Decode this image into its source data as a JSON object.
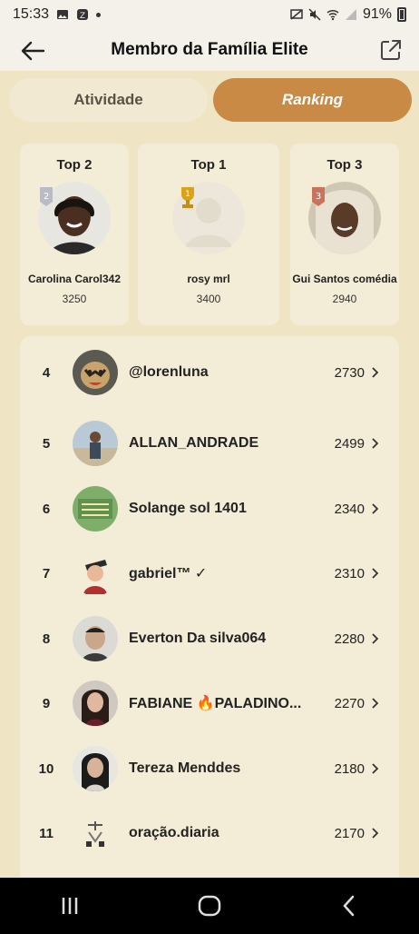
{
  "status_bar": {
    "time": "15:33",
    "battery": "91%"
  },
  "header": {
    "title": "Membro da Família Elite"
  },
  "tabs": [
    {
      "label": "Atividade",
      "active": false
    },
    {
      "label": "Ranking",
      "active": true
    }
  ],
  "podium": [
    {
      "rank_label": "Top 2",
      "name": "Carolina Carol342",
      "score": "3250",
      "badge_num": "2"
    },
    {
      "rank_label": "Top 1",
      "name": "rosy mrl",
      "score": "3400",
      "badge_num": "1"
    },
    {
      "rank_label": "Top 3",
      "name": "Gui Santos comédia",
      "score": "2940",
      "badge_num": "3"
    }
  ],
  "ranking": [
    {
      "rank": "4",
      "name": "@lorenluna",
      "score": "2730"
    },
    {
      "rank": "5",
      "name": "ALLAN_ANDRADE",
      "score": "2499"
    },
    {
      "rank": "6",
      "name": "Solange sol 1401",
      "score": "2340"
    },
    {
      "rank": "7",
      "name": "gabriel™ ✓",
      "score": "2310"
    },
    {
      "rank": "8",
      "name": "Everton Da silva064",
      "score": "2280"
    },
    {
      "rank": "9",
      "name": "FABIANE 🔥PALADINO...",
      "score": "2270"
    },
    {
      "rank": "10",
      "name": "Tereza Menddes",
      "score": "2180"
    },
    {
      "rank": "11",
      "name": "oração.diaria",
      "score": "2170"
    }
  ],
  "colors": {
    "background": "#efe4c4",
    "accent": "#c98a45",
    "card": "#f3ecd6"
  }
}
